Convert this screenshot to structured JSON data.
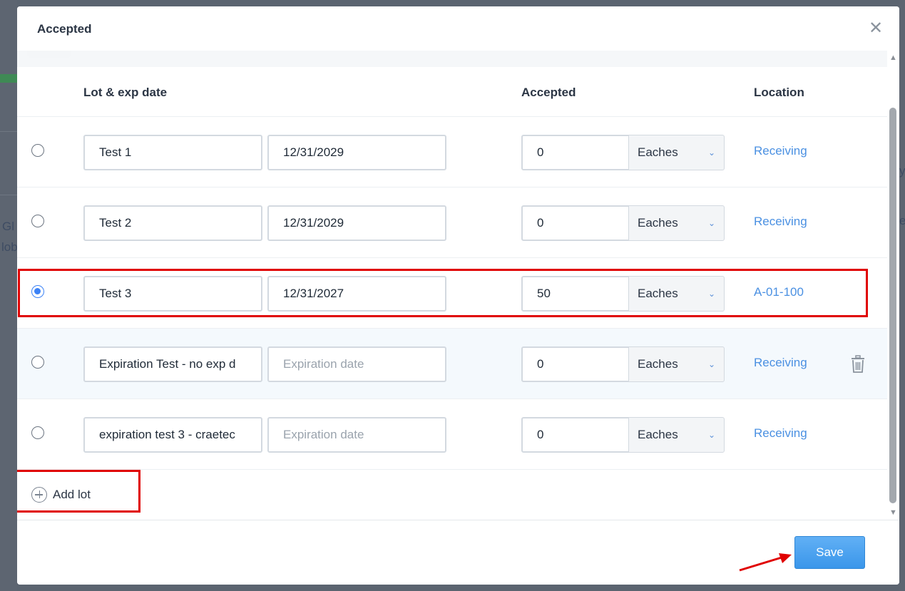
{
  "background": {
    "snippets": [
      "Gl",
      "lob",
      "y",
      "e"
    ]
  },
  "modal": {
    "title": "Accepted",
    "close_icon": "close-icon"
  },
  "table": {
    "headers": {
      "lot": "Lot & exp date",
      "accepted": "Accepted",
      "location": "Location"
    },
    "rows": [
      {
        "selected": false,
        "lot": "Test 1",
        "exp": "12/31/2029",
        "exp_placeholder": "Expiration date",
        "qty": "0",
        "unit": "Eaches",
        "location": "Receiving",
        "trash": false
      },
      {
        "selected": false,
        "lot": "Test 2",
        "exp": "12/31/2029",
        "exp_placeholder": "Expiration date",
        "qty": "0",
        "unit": "Eaches",
        "location": "Receiving",
        "trash": false
      },
      {
        "selected": true,
        "lot": "Test 3",
        "exp": "12/31/2027",
        "exp_placeholder": "Expiration date",
        "qty": "50",
        "unit": "Eaches",
        "location": "A-01-100",
        "trash": false
      },
      {
        "selected": false,
        "lot": "Expiration Test - no exp d",
        "exp": "",
        "exp_placeholder": "Expiration date",
        "qty": "0",
        "unit": "Eaches",
        "location": "Receiving",
        "trash": true
      },
      {
        "selected": false,
        "lot": "expiration test 3 - craetec",
        "exp": "",
        "exp_placeholder": "Expiration date",
        "qty": "0",
        "unit": "Eaches",
        "location": "Receiving",
        "trash": false
      }
    ]
  },
  "add_lot": {
    "label": "Add lot",
    "icon": "plus-circle-icon"
  },
  "footer": {
    "save_label": "Save"
  },
  "annotations": {
    "highlight_color": "#e00000",
    "accent": "#3b82f6",
    "link_color": "#4a90e2"
  }
}
